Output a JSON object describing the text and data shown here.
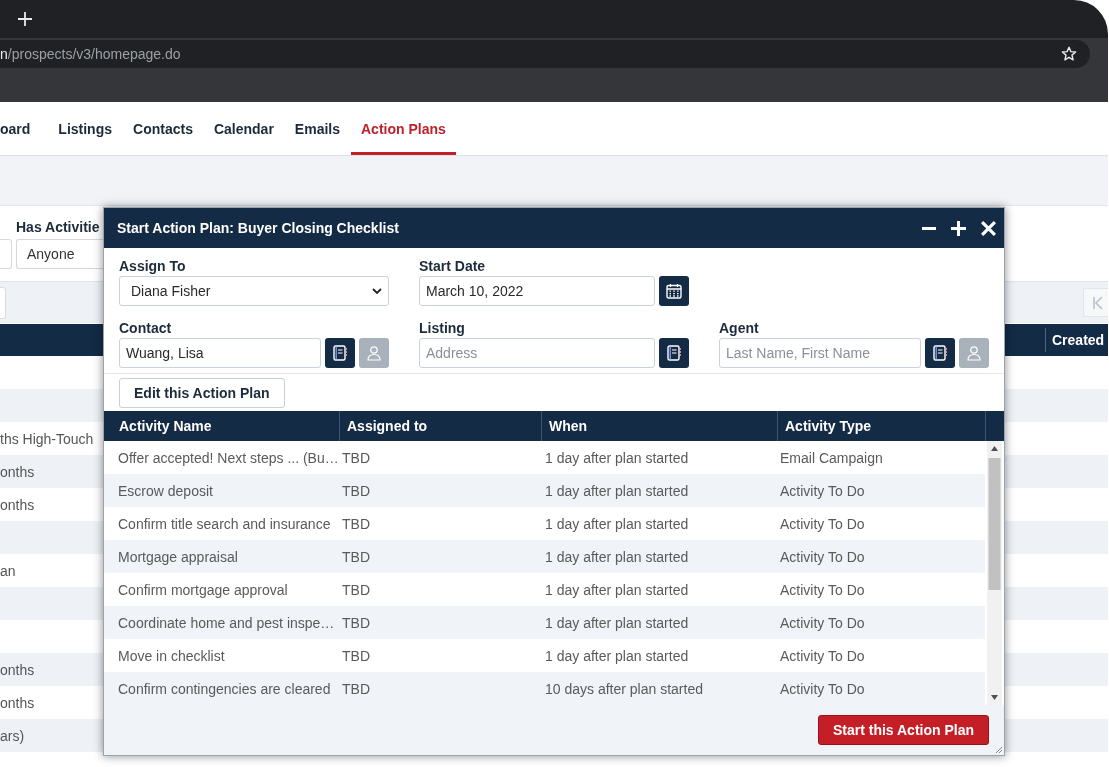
{
  "browser": {
    "url": {
      "host_tail": "n",
      "path": "/prospects/v3/homepage.do"
    }
  },
  "nav": {
    "items": [
      {
        "label": "oard",
        "selected": false
      },
      {
        "label": "Listings",
        "selected": false
      },
      {
        "label": "Contacts",
        "selected": false
      },
      {
        "label": "Calendar",
        "selected": false
      },
      {
        "label": "Emails",
        "selected": false
      },
      {
        "label": "Action Plans",
        "selected": true
      }
    ]
  },
  "filters": {
    "has_activities": {
      "label": "Has Activitie",
      "value": "Anyone"
    }
  },
  "background_table": {
    "columns": [
      {
        "label": "Created"
      }
    ],
    "rows": [
      {},
      {},
      {
        "column_1": "ths High-Touch"
      },
      {
        "column_1": "onths"
      },
      {
        "column_1": "onths"
      },
      {},
      {
        "column_1": "an"
      },
      {},
      {},
      {
        "column_1": "onths"
      },
      {
        "column_1": "onths"
      },
      {
        "column_1": "ars)"
      }
    ]
  },
  "dialog": {
    "title": "Start Action Plan: Buyer Closing Checklist",
    "field_rows": [
      [
        {
          "kind": "select",
          "label": "Assign To",
          "value": "Diana Fisher"
        },
        {
          "kind": "date",
          "label": "Start Date",
          "value": "March 10, 2022"
        }
      ],
      [
        {
          "kind": "lookup",
          "label": "Contact",
          "value": "Wuang, Lisa",
          "profile_button": {
            "disabled": true
          }
        },
        {
          "kind": "lookup",
          "label": "Listing",
          "placeholder": "Address"
        },
        {
          "kind": "lookup",
          "label": "Agent",
          "placeholder": "Last Name, First Name",
          "profile_button": {
            "disabled": true
          }
        }
      ]
    ],
    "edit_button": "Edit this Action Plan",
    "activities": {
      "columns": [
        "Activity Name",
        "Assigned to",
        "When",
        "Activity Type"
      ],
      "rows": [
        {
          "activity_name": "Offer accepted! Next steps ... (Bu…",
          "assigned_to": "TBD",
          "when": "1 day after plan started",
          "activity_type": "Email Campaign"
        },
        {
          "activity_name": "Escrow deposit",
          "assigned_to": "TBD",
          "when": "1 day after plan started",
          "activity_type": "Activity To Do"
        },
        {
          "activity_name": "Confirm title search and insurance",
          "assigned_to": "TBD",
          "when": "1 day after plan started",
          "activity_type": "Activity To Do"
        },
        {
          "activity_name": "Mortgage appraisal",
          "assigned_to": "TBD",
          "when": "1 day after plan started",
          "activity_type": "Activity To Do"
        },
        {
          "activity_name": "Confirm mortgage approval",
          "assigned_to": "TBD",
          "when": "1 day after plan started",
          "activity_type": "Activity To Do"
        },
        {
          "activity_name": "Coordinate home and pest inspe…",
          "assigned_to": "TBD",
          "when": "1 day after plan started",
          "activity_type": "Activity To Do"
        },
        {
          "activity_name": "Move in checklist",
          "assigned_to": "TBD",
          "when": "1 day after plan started",
          "activity_type": "Activity To Do"
        },
        {
          "activity_name": "Confirm contingencies are cleared",
          "assigned_to": "TBD",
          "when": "10 days after plan started",
          "activity_type": "Activity To Do"
        }
      ]
    },
    "start_button": "Start this Action Plan"
  }
}
